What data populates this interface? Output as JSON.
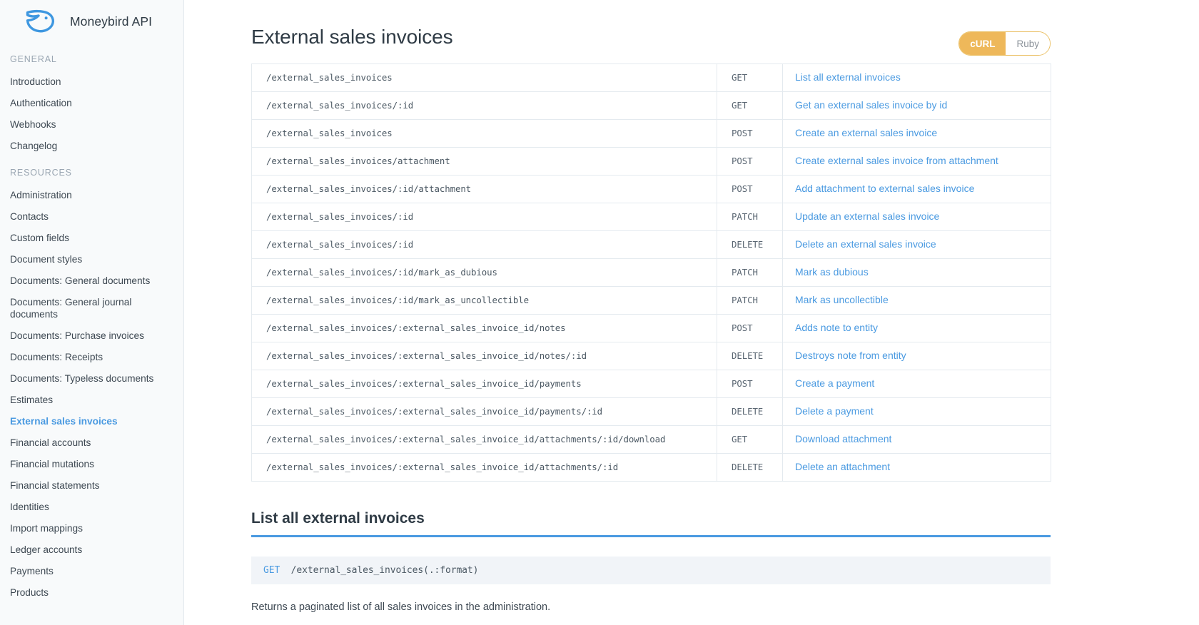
{
  "brand": {
    "title": "Moneybird API",
    "logo_icon": "bird-logo-icon",
    "logo_color": "#3e97e0"
  },
  "sidebar": {
    "groups": [
      {
        "heading": "GENERAL",
        "items": [
          {
            "label": "Introduction",
            "active": false
          },
          {
            "label": "Authentication",
            "active": false
          },
          {
            "label": "Webhooks",
            "active": false
          },
          {
            "label": "Changelog",
            "active": false
          }
        ]
      },
      {
        "heading": "RESOURCES",
        "items": [
          {
            "label": "Administration",
            "active": false
          },
          {
            "label": "Contacts",
            "active": false
          },
          {
            "label": "Custom fields",
            "active": false
          },
          {
            "label": "Document styles",
            "active": false
          },
          {
            "label": "Documents: General documents",
            "active": false
          },
          {
            "label": "Documents: General journal documents",
            "active": false
          },
          {
            "label": "Documents: Purchase invoices",
            "active": false
          },
          {
            "label": "Documents: Receipts",
            "active": false
          },
          {
            "label": "Documents: Typeless documents",
            "active": false
          },
          {
            "label": "Estimates",
            "active": false
          },
          {
            "label": "External sales invoices",
            "active": true
          },
          {
            "label": "Financial accounts",
            "active": false
          },
          {
            "label": "Financial mutations",
            "active": false
          },
          {
            "label": "Financial statements",
            "active": false
          },
          {
            "label": "Identities",
            "active": false
          },
          {
            "label": "Import mappings",
            "active": false
          },
          {
            "label": "Ledger accounts",
            "active": false
          },
          {
            "label": "Payments",
            "active": false
          },
          {
            "label": "Products",
            "active": false
          }
        ]
      }
    ]
  },
  "main": {
    "page_title": "External sales invoices",
    "language_toggle": {
      "options": [
        {
          "label": "cURL",
          "active": true
        },
        {
          "label": "Ruby",
          "active": false
        }
      ],
      "active_color": "#eeb85a",
      "border_color": "#eabf62"
    },
    "endpoints": [
      {
        "path": "/external_sales_invoices",
        "method": "GET",
        "description": "List all external invoices"
      },
      {
        "path": "/external_sales_invoices/:id",
        "method": "GET",
        "description": "Get an external sales invoice by id"
      },
      {
        "path": "/external_sales_invoices",
        "method": "POST",
        "description": "Create an external sales invoice"
      },
      {
        "path": "/external_sales_invoices/attachment",
        "method": "POST",
        "description": "Create external sales invoice from attachment"
      },
      {
        "path": "/external_sales_invoices/:id/attachment",
        "method": "POST",
        "description": "Add attachment to external sales invoice"
      },
      {
        "path": "/external_sales_invoices/:id",
        "method": "PATCH",
        "description": "Update an external sales invoice"
      },
      {
        "path": "/external_sales_invoices/:id",
        "method": "DELETE",
        "description": "Delete an external sales invoice"
      },
      {
        "path": "/external_sales_invoices/:id/mark_as_dubious",
        "method": "PATCH",
        "description": "Mark as dubious"
      },
      {
        "path": "/external_sales_invoices/:id/mark_as_uncollectible",
        "method": "PATCH",
        "description": "Mark as uncollectible"
      },
      {
        "path": "/external_sales_invoices/:external_sales_invoice_id/notes",
        "method": "POST",
        "description": "Adds note to entity"
      },
      {
        "path": "/external_sales_invoices/:external_sales_invoice_id/notes/:id",
        "method": "DELETE",
        "description": "Destroys note from entity"
      },
      {
        "path": "/external_sales_invoices/:external_sales_invoice_id/payments",
        "method": "POST",
        "description": "Create a payment"
      },
      {
        "path": "/external_sales_invoices/:external_sales_invoice_id/payments/:id",
        "method": "DELETE",
        "description": "Delete a payment"
      },
      {
        "path": "/external_sales_invoices/:external_sales_invoice_id/attachments/:id/download",
        "method": "GET",
        "description": "Download attachment"
      },
      {
        "path": "/external_sales_invoices/:external_sales_invoice_id/attachments/:id",
        "method": "DELETE",
        "description": "Delete an attachment"
      }
    ],
    "section": {
      "title": "List all external invoices",
      "code_method": "GET",
      "code_path": "/external_sales_invoices(.:format)",
      "paragraph": "Returns a paginated list of all sales invoices in the administration.",
      "accent_color": "#4a9ae1"
    }
  }
}
